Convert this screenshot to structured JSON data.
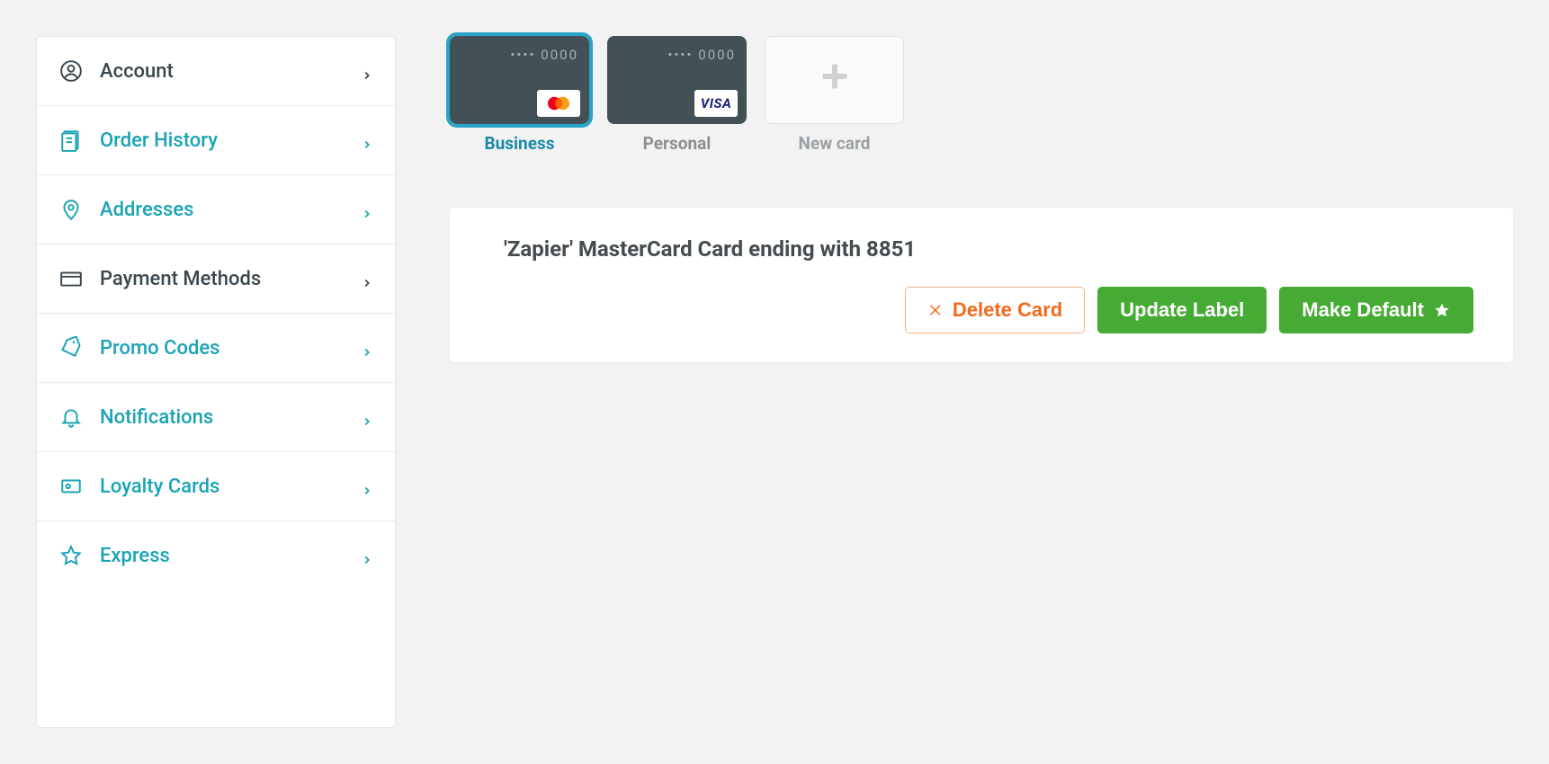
{
  "sidebar": {
    "items": [
      {
        "label": "Account",
        "icon": "user-icon",
        "active": false,
        "dark": true
      },
      {
        "label": "Order History",
        "icon": "receipt-icon",
        "active": false,
        "dark": false
      },
      {
        "label": "Addresses",
        "icon": "pin-icon",
        "active": false,
        "dark": false
      },
      {
        "label": "Payment Methods",
        "icon": "card-icon",
        "active": true,
        "dark": true
      },
      {
        "label": "Promo Codes",
        "icon": "tag-icon",
        "active": false,
        "dark": false
      },
      {
        "label": "Notifications",
        "icon": "bell-icon",
        "active": false,
        "dark": false
      },
      {
        "label": "Loyalty Cards",
        "icon": "loyalty-icon",
        "active": false,
        "dark": false
      },
      {
        "label": "Express",
        "icon": "star-icon",
        "active": false,
        "dark": false
      }
    ]
  },
  "cards": [
    {
      "masked": "•••• 0000",
      "label": "Business",
      "brand": "mastercard",
      "selected": true
    },
    {
      "masked": "•••• 0000",
      "label": "Personal",
      "brand": "visa",
      "selected": false
    }
  ],
  "new_card_label": "New card",
  "card_detail": {
    "title": "'Zapier' MasterCard Card ending with 8851",
    "delete_label": "Delete Card",
    "update_label": "Update Label",
    "default_label": "Make Default"
  },
  "brand_text": {
    "visa": "VISA"
  }
}
